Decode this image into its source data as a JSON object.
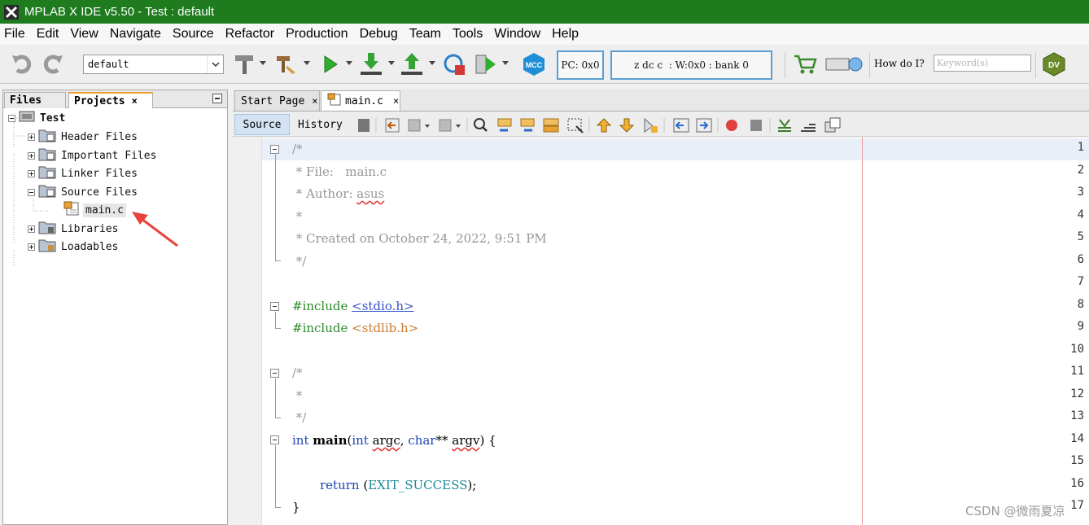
{
  "window": {
    "title": "MPLAB X IDE v5.50 - Test : default"
  },
  "menu": [
    "File",
    "Edit",
    "View",
    "Navigate",
    "Source",
    "Refactor",
    "Production",
    "Debug",
    "Team",
    "Tools",
    "Window",
    "Help"
  ],
  "toolbar": {
    "configuration": "default",
    "pc_register": "PC: 0x0",
    "status_register": "z dc c  : W:0x0 : bank 0",
    "howdoi_label": "How do I?",
    "keyword_placeholder": "Keyword(s)",
    "mcc_label": "MCC",
    "dv_label": "DV"
  },
  "left_panel": {
    "tabs": [
      {
        "label": "Files"
      },
      {
        "label": "Projects",
        "close": "×"
      }
    ],
    "project_name": "Test",
    "folders": [
      "Header Files",
      "Important Files",
      "Linker Files",
      "Source Files",
      "Libraries",
      "Loadables"
    ],
    "source_file": "main.c"
  },
  "editor": {
    "tabs": [
      {
        "label": "Start Page",
        "close": "×"
      },
      {
        "label": "main.c",
        "close": "×"
      }
    ],
    "view_tabs": {
      "source": "Source",
      "history": "History"
    },
    "line_numbers": [
      "1",
      "2",
      "3",
      "4",
      "5",
      "6",
      "7",
      "8",
      "9",
      "10",
      "11",
      "12",
      "13",
      "14",
      "15",
      "16",
      "17"
    ],
    "code": {
      "l1": "/*",
      "l2": " * File:   main.c",
      "l3_prefix": " * Author: ",
      "l3_author": "asus",
      "l4": " *",
      "l5": " * Created on October 24, 2022, 9:51 PM",
      "l6": " */",
      "l8_directive": "#include ",
      "l8_header": "<stdio.h>",
      "l9_directive": "#include ",
      "l9_header": "<stdlib.h>",
      "l11": "/*",
      "l12": " *",
      "l13": " */",
      "l14_int": "int",
      "l14_main": "main",
      "l14_paren": "(",
      "l14_int2": "int",
      "l14_argc": "argc",
      "l14_comma": ", ",
      "l14_char": "char",
      "l14_stars": "**",
      "l14_argv": "argv",
      "l14_close": ") {",
      "l16_return": "return",
      "l16_open": " (",
      "l16_macro": "EXIT_SUCCESS",
      "l16_close": ");",
      "l17": "}"
    }
  },
  "watermark": "CSDN @微雨夏凉",
  "colors": {
    "titlebar": "#1e7b1e",
    "comment": "#969696",
    "preprocessor": "#2d8a2d",
    "keyword": "#1f44b5",
    "annotation_arrow": "#e8433a"
  }
}
